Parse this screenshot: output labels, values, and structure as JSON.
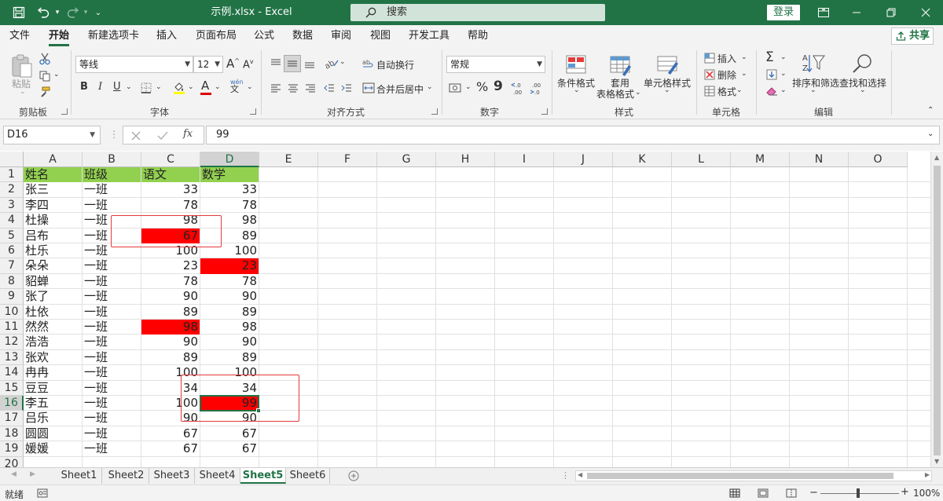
{
  "titlebar": {
    "title": "示例.xlsx  -  Excel",
    "search_placeholder": "搜索",
    "login_label": "登录"
  },
  "menu": {
    "tabs": [
      "文件",
      "开始",
      "新建选项卡",
      "插入",
      "页面布局",
      "公式",
      "数据",
      "审阅",
      "视图",
      "开发工具",
      "帮助"
    ],
    "active": "开始",
    "share_label": "共享"
  },
  "ribbon": {
    "clipboard": {
      "paste_label": "粘贴",
      "group_label": "剪贴板"
    },
    "font": {
      "font_name": "等线",
      "font_size": "12",
      "grow_label": "A",
      "shrink_label": "A",
      "bold": "B",
      "italic": "I",
      "underline": "U",
      "font_color_label": "A",
      "phonetic_label": "wén",
      "group_label": "字体"
    },
    "alignment": {
      "wrap_label": "自动换行",
      "merge_label": "合并后居中",
      "group_label": "对齐方式"
    },
    "number": {
      "format": "常规",
      "percent": "%",
      "comma": "9",
      "group_label": "数字"
    },
    "styles": {
      "conditional_label": "条件格式",
      "table_label_1": "套用",
      "table_label_2": "表格格式",
      "cell_style_label": "单元格样式",
      "group_label": "样式"
    },
    "cells": {
      "insert_label": "插入",
      "delete_label": "删除",
      "format_label": "格式",
      "group_label": "单元格"
    },
    "editing": {
      "sort_label": "排序和筛选",
      "find_label": "查找和选择",
      "group_label": "编辑"
    }
  },
  "formula_bar": {
    "name_box": "D16",
    "fx": "fx",
    "value": "99"
  },
  "sheet": {
    "columns": [
      "A",
      "B",
      "C",
      "D",
      "E",
      "F",
      "G",
      "H",
      "I",
      "J",
      "K",
      "L",
      "M",
      "N",
      "O"
    ],
    "row_numbers": [
      "1",
      "2",
      "3",
      "4",
      "5",
      "6",
      "7",
      "8",
      "9",
      "10",
      "11",
      "12",
      "13",
      "14",
      "15",
      "16",
      "17",
      "18",
      "19",
      "20"
    ],
    "selected_cell": "D16",
    "header_fill": "#92d050",
    "highlight_fill": "#ff0000",
    "rows": [
      [
        "姓名",
        "班级",
        "语文",
        "数学"
      ],
      [
        "张三",
        "一班",
        "33",
        "33"
      ],
      [
        "李四",
        "一班",
        "78",
        "78"
      ],
      [
        "杜操",
        "一班",
        "98",
        "98"
      ],
      [
        "吕布",
        "一班",
        "67",
        "89"
      ],
      [
        "杜乐",
        "一班",
        "100",
        "100"
      ],
      [
        "朵朵",
        "一班",
        "23",
        "23"
      ],
      [
        "貂蝉",
        "一班",
        "78",
        "78"
      ],
      [
        "张了",
        "一班",
        "90",
        "90"
      ],
      [
        "杜依",
        "一班",
        "89",
        "89"
      ],
      [
        "然然",
        "一班",
        "98",
        "98"
      ],
      [
        "浩浩",
        "一班",
        "90",
        "90"
      ],
      [
        "张欢",
        "一班",
        "89",
        "89"
      ],
      [
        "冉冉",
        "一班",
        "100",
        "100"
      ],
      [
        "豆豆",
        "一班",
        "34",
        "34"
      ],
      [
        "李五",
        "一班",
        "100",
        "99"
      ],
      [
        "吕乐",
        "一班",
        "90",
        "90"
      ],
      [
        "圆圆",
        "一班",
        "67",
        "67"
      ],
      [
        "媛媛",
        "一班",
        "67",
        "67"
      ]
    ],
    "red_cells": [
      [
        4,
        2
      ],
      [
        6,
        3
      ],
      [
        10,
        2
      ],
      [
        15,
        3
      ]
    ]
  },
  "sheet_tabs": {
    "tabs": [
      "Sheet1",
      "Sheet2",
      "Sheet3",
      "Sheet4",
      "Sheet5",
      "Sheet6"
    ],
    "active": "Sheet5"
  },
  "status": {
    "ready": "就绪",
    "zoom": "100%"
  }
}
